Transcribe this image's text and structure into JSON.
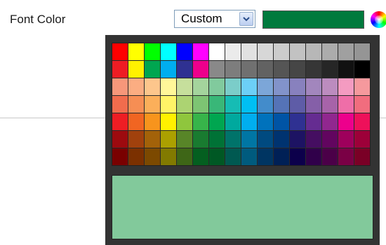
{
  "setting": {
    "label": "Font Color"
  },
  "dropdown": {
    "selected": "Custom",
    "icon": "chevron-down-icon"
  },
  "current_color": "#007a3d",
  "color_wheel_icon": "color-wheel-icon",
  "preview_color": "#82c99b",
  "palette": [
    [
      "#ff0000",
      "#ffff00",
      "#00ff00",
      "#00ffff",
      "#0000ff",
      "#ff00ff",
      "#ffffff",
      "#ebebeb",
      "#e1e1e1",
      "#d7d7d7",
      "#cccccc",
      "#c2c2c2",
      "#b7b7b7",
      "#acacac",
      "#a0a0a0",
      "#959595"
    ],
    [
      "#ee1d24",
      "#fff100",
      "#00a650",
      "#00aeef",
      "#2f3192",
      "#ed008c",
      "#898989",
      "#7d7d7d",
      "#707070",
      "#626262",
      "#555555",
      "#464646",
      "#363636",
      "#262626",
      "#111111",
      "#000000"
    ],
    [
      "#f7977a",
      "#fbad82",
      "#fdc68c",
      "#fff799",
      "#c6df9c",
      "#a4d49d",
      "#81ca9d",
      "#7bcdc9",
      "#6ccff7",
      "#7ca6d8",
      "#8293ca",
      "#8881be",
      "#a286bd",
      "#bc8cbf",
      "#f49bc1",
      "#f5999d"
    ],
    [
      "#f16c4d",
      "#f68e54",
      "#fbaf5a",
      "#fff467",
      "#acd372",
      "#7dc473",
      "#39b778",
      "#16bcb4",
      "#00bff3",
      "#438ccb",
      "#5573b7",
      "#5e5ca7",
      "#855fa8",
      "#a763a9",
      "#ef6ea8",
      "#f16d7e"
    ],
    [
      "#ee1d24",
      "#f16522",
      "#f7941d",
      "#fff100",
      "#8fc63d",
      "#37b44a",
      "#00a650",
      "#00a99e",
      "#00aeef",
      "#0072bc",
      "#0054a5",
      "#2f3192",
      "#652c91",
      "#91278f",
      "#ed008c",
      "#ee105a"
    ],
    [
      "#9d0a0f",
      "#a1410d",
      "#a36209",
      "#aba000",
      "#588528",
      "#197b30",
      "#007236",
      "#00736a",
      "#0076a4",
      "#004a80",
      "#003370",
      "#1d1363",
      "#450e61",
      "#62055f",
      "#9e005c",
      "#9d0039"
    ],
    [
      "#790000",
      "#7b3000",
      "#7c4900",
      "#827a00",
      "#3e6617",
      "#045f20",
      "#005824",
      "#005951",
      "#005b7e",
      "#003562",
      "#002056",
      "#0c004b",
      "#30004a",
      "#4b0048",
      "#7a0045",
      "#7a0026"
    ]
  ]
}
